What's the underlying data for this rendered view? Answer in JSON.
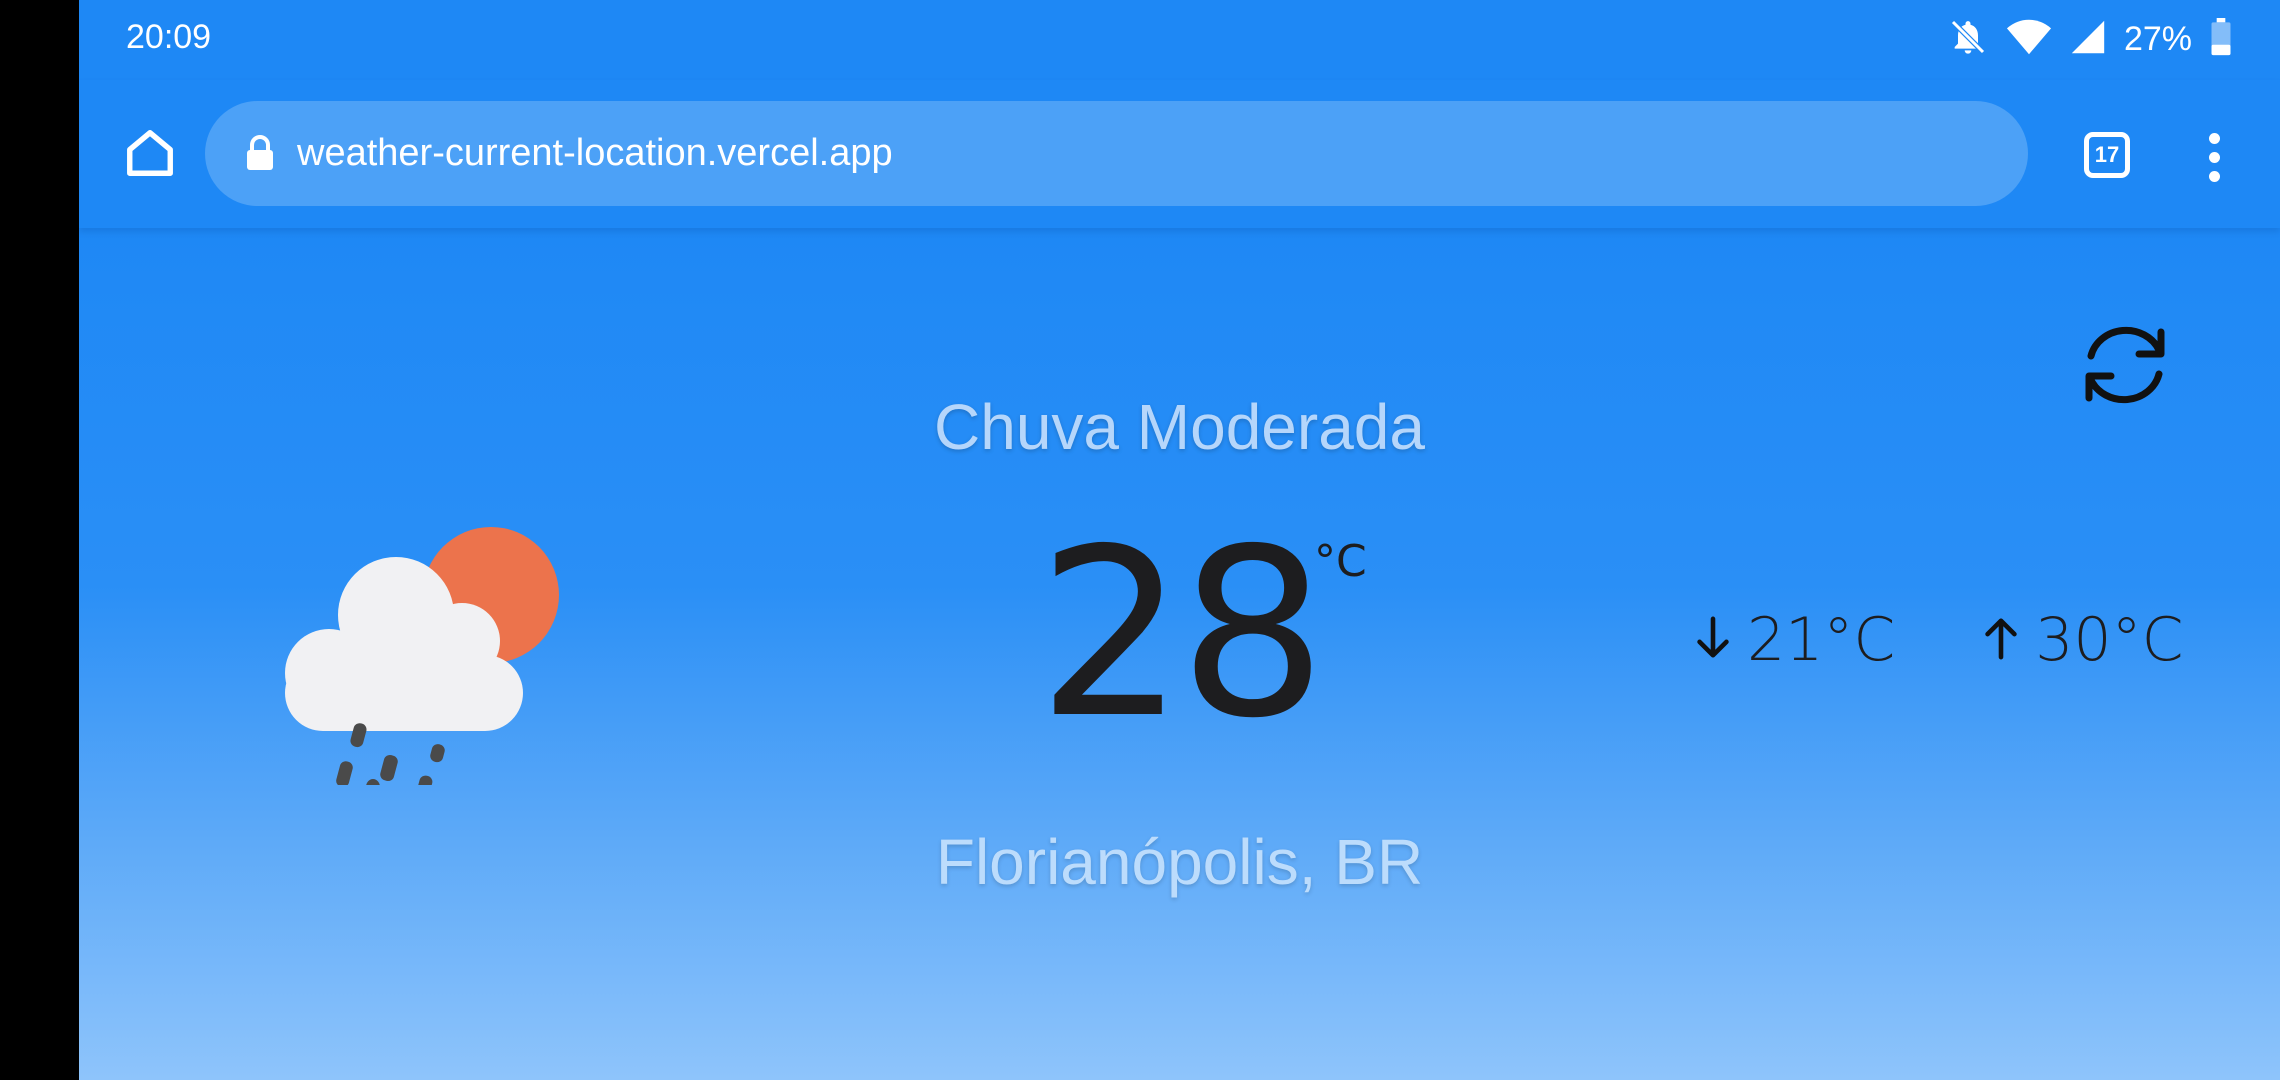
{
  "status_bar": {
    "time": "20:09",
    "battery_percent": "27%",
    "icons": [
      "notifications-off-icon",
      "wifi-icon",
      "cell-signal-icon",
      "battery-icon"
    ]
  },
  "browser": {
    "url": "weather-current-location.vercel.app",
    "tab_count": "17",
    "icons": [
      "home-icon",
      "lock-icon",
      "tabs-icon",
      "more-vert-icon"
    ]
  },
  "weather": {
    "condition": "Chuva Moderada",
    "temperature": "28",
    "unit": "°C",
    "min_temp": "21°C",
    "max_temp": "30°C",
    "location": "Florianópolis, BR",
    "icon": "rain-cloud-sun-icon",
    "refresh_icon": "refresh-icon"
  },
  "colors": {
    "background": "#1e88f5",
    "url_bar": "#4ca1f7",
    "sun": "#ec734c",
    "cloud": "#f1f1f3",
    "rain": "#4a4a4a",
    "text_dark": "#1d1d1f"
  }
}
